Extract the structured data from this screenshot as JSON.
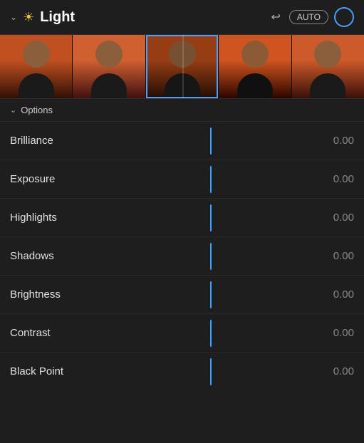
{
  "header": {
    "chevron": "chevron-down",
    "title": "Light",
    "undo_label": "↩",
    "auto_label": "AUTO"
  },
  "options": {
    "label": "Options"
  },
  "sliders": [
    {
      "label": "Brilliance",
      "value": "0.00"
    },
    {
      "label": "Exposure",
      "value": "0.00"
    },
    {
      "label": "Highlights",
      "value": "0.00"
    },
    {
      "label": "Shadows",
      "value": "0.00"
    },
    {
      "label": "Brightness",
      "value": "0.00"
    },
    {
      "label": "Contrast",
      "value": "0.00"
    },
    {
      "label": "Black Point",
      "value": "0.00"
    }
  ],
  "filmstrip": {
    "count": 5
  }
}
